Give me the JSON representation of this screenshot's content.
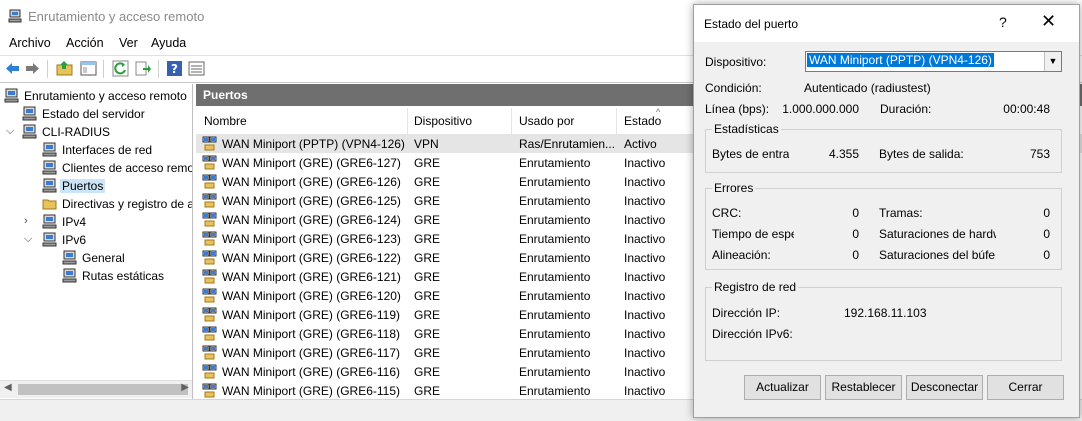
{
  "window": {
    "title": "Enrutamiento y acceso remoto"
  },
  "menu": [
    "Archivo",
    "Acción",
    "Ver",
    "Ayuda"
  ],
  "tree": {
    "root": "Enrutamiento y acceso remoto",
    "server_status": "Estado del servidor",
    "server": "CLI-RADIUS",
    "items": [
      "Interfaces de red",
      "Clientes de acceso remo",
      "Puertos",
      "Directivas y registro de a",
      "IPv4",
      "IPv6",
      "General",
      "Rutas estáticas"
    ]
  },
  "pane": {
    "title": "Puertos",
    "columns": [
      "Nombre",
      "Dispositivo",
      "Usado por",
      "Estado"
    ],
    "rows": [
      [
        "WAN Miniport (PPTP) (VPN4-126)",
        "VPN",
        "Ras/Enrutamien...",
        "Activo"
      ],
      [
        "WAN Miniport (GRE) (GRE6-127)",
        "GRE",
        "Enrutamiento",
        "Inactivo"
      ],
      [
        "WAN Miniport (GRE) (GRE6-126)",
        "GRE",
        "Enrutamiento",
        "Inactivo"
      ],
      [
        "WAN Miniport (GRE) (GRE6-125)",
        "GRE",
        "Enrutamiento",
        "Inactivo"
      ],
      [
        "WAN Miniport (GRE) (GRE6-124)",
        "GRE",
        "Enrutamiento",
        "Inactivo"
      ],
      [
        "WAN Miniport (GRE) (GRE6-123)",
        "GRE",
        "Enrutamiento",
        "Inactivo"
      ],
      [
        "WAN Miniport (GRE) (GRE6-122)",
        "GRE",
        "Enrutamiento",
        "Inactivo"
      ],
      [
        "WAN Miniport (GRE) (GRE6-121)",
        "GRE",
        "Enrutamiento",
        "Inactivo"
      ],
      [
        "WAN Miniport (GRE) (GRE6-120)",
        "GRE",
        "Enrutamiento",
        "Inactivo"
      ],
      [
        "WAN Miniport (GRE) (GRE6-119)",
        "GRE",
        "Enrutamiento",
        "Inactivo"
      ],
      [
        "WAN Miniport (GRE) (GRE6-118)",
        "GRE",
        "Enrutamiento",
        "Inactivo"
      ],
      [
        "WAN Miniport (GRE) (GRE6-117)",
        "GRE",
        "Enrutamiento",
        "Inactivo"
      ],
      [
        "WAN Miniport (GRE) (GRE6-116)",
        "GRE",
        "Enrutamiento",
        "Inactivo"
      ],
      [
        "WAN Miniport (GRE) (GRE6-115)",
        "GRE",
        "Enrutamiento",
        "Inactivo"
      ]
    ]
  },
  "dialog": {
    "title": "Estado del puerto",
    "help": "?",
    "close": "✕",
    "device_label": "Dispositivo:",
    "device_value": "WAN Miniport (PPTP) (VPN4-126)",
    "condition_label": "Condición:",
    "condition_value": "Autenticado (radiustest)",
    "line_label": "Línea (bps):",
    "line_value": "1.000.000.000",
    "duration_label": "Duración:",
    "duration_value": "00:00:48",
    "stats_title": "Estadísticas",
    "bytes_in_label": "Bytes de entrada",
    "bytes_in_value": "4.355",
    "bytes_out_label": "Bytes de salida:",
    "bytes_out_value": "753",
    "errors_title": "Errores",
    "crc_label": "CRC:",
    "crc_value": "0",
    "frames_label": "Tramas:",
    "frames_value": "0",
    "timeout_label": "Tiempo de espera",
    "timeout_value": "0",
    "hw_label": "Saturaciones de hardwa",
    "hw_value": "0",
    "align_label": "Alineación:",
    "align_value": "0",
    "buffer_label": "Saturaciones del búfe",
    "buffer_value": "0",
    "netlog_title": "Registro de red",
    "ip_label": "Dirección IP:",
    "ip_value": "192.168.11.103",
    "ipv6_label": "Dirección IPv6:",
    "ipv6_value": "",
    "buttons": [
      "Actualizar",
      "Restablecer",
      "Desconectar",
      "Cerrar"
    ]
  },
  "colors": {
    "selection": "#0078d7",
    "pane_header": "#6f6f6f",
    "tree_selection": "#cce4f7"
  }
}
